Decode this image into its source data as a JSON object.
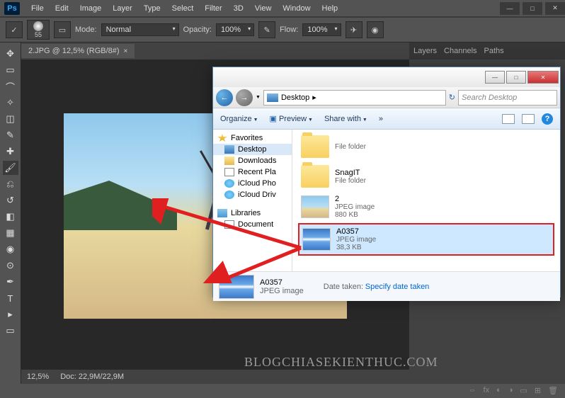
{
  "app": {
    "logo": "Ps"
  },
  "menubar": [
    "File",
    "Edit",
    "Image",
    "Layer",
    "Type",
    "Select",
    "Filter",
    "3D",
    "View",
    "Window",
    "Help"
  ],
  "options": {
    "brush_size": "55",
    "mode_label": "Mode:",
    "mode_value": "Normal",
    "opacity_label": "Opacity:",
    "opacity_value": "100%",
    "flow_label": "Flow:",
    "flow_value": "100%"
  },
  "doc_tab": {
    "title": "2.JPG @ 12,5% (RGB/8#)",
    "close": "×"
  },
  "status": {
    "zoom": "12,5%",
    "doc": "Doc: 22,9M/22,9M"
  },
  "panels": {
    "tabs": [
      "Layers",
      "Channels",
      "Paths"
    ]
  },
  "explorer": {
    "nav": {
      "location": "Desktop",
      "crumb": "▸",
      "search_placeholder": "Search Desktop"
    },
    "toolbar": {
      "organize": "Organize",
      "preview": "Preview",
      "share": "Share with",
      "more": "»"
    },
    "tree": {
      "favorites": "Favorites",
      "items": [
        {
          "label": "Desktop"
        },
        {
          "label": "Downloads"
        },
        {
          "label": "Recent Pla"
        },
        {
          "label": "iCloud Pho"
        },
        {
          "label": "iCloud Driv"
        }
      ],
      "libraries": "Libraries",
      "documents": "Document"
    },
    "files": [
      {
        "name": "",
        "type": "File folder",
        "thumb": "folder"
      },
      {
        "name": "SnagIT",
        "type": "File folder",
        "thumb": "folder"
      },
      {
        "name": "2",
        "type": "JPEG image",
        "size": "880 KB",
        "thumb": "beach"
      },
      {
        "name": "A0357",
        "type": "JPEG image",
        "size": "38,3 KB",
        "thumb": "sky",
        "selected": true
      }
    ],
    "detail": {
      "name": "A0357",
      "type": "JPEG image",
      "date_label": "Date taken:",
      "date_value": "Specify date taken"
    }
  },
  "watermark": "BLOGCHIASEKIENTHUC.COM"
}
